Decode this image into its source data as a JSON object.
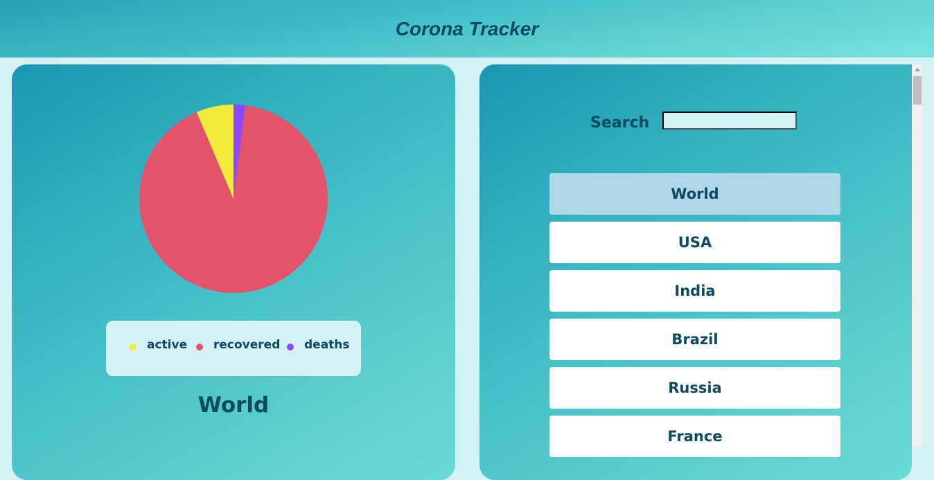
{
  "header": {
    "title": "Corona Tracker"
  },
  "chart_data": {
    "type": "pie",
    "labels": [
      "active",
      "recovered",
      "deaths"
    ],
    "values": [
      6.4,
      91.6,
      2.0
    ],
    "colors": [
      "#f2ec3b",
      "#e3536b",
      "#9146fc"
    ],
    "legend": "bottom"
  },
  "left": {
    "country_title": "World"
  },
  "search": {
    "label": "Search",
    "value": ""
  },
  "countries": [
    {
      "label": "World",
      "selected": true
    },
    {
      "label": "USA"
    },
    {
      "label": "India"
    },
    {
      "label": "Brazil"
    },
    {
      "label": "Russia"
    },
    {
      "label": "France"
    }
  ],
  "colors": {
    "text": "#0b4a63",
    "background": "#d4f1f4",
    "selected": "#aed8e5"
  }
}
